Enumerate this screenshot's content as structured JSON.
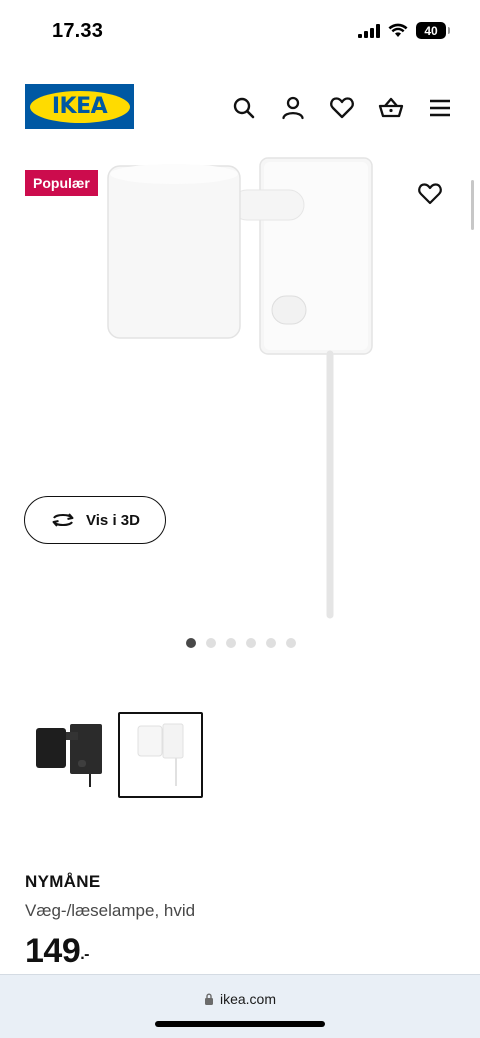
{
  "status_bar": {
    "time": "17.33",
    "battery": "40",
    "icons": [
      "signal-icon",
      "wifi-icon",
      "battery-icon"
    ]
  },
  "header": {
    "logo_text": "IKEA",
    "icons": [
      "search-icon",
      "user-icon",
      "heart-icon",
      "basket-icon",
      "menu-icon"
    ]
  },
  "product_image": {
    "badge": "Populær",
    "view_3d_label": "Vis i 3D",
    "carousel_count": 6,
    "carousel_active_index": 0
  },
  "thumbnails": [
    {
      "name": "black-lamp",
      "selected": false
    },
    {
      "name": "white-lamp",
      "selected": true
    }
  ],
  "product": {
    "name": "NYMÅNE",
    "description": "Væg-/læselampe, hvid",
    "price": "149",
    "price_suffix": ".-"
  },
  "browser": {
    "url": "ikea.com"
  },
  "colors": {
    "brand_blue": "#0058a3",
    "brand_yellow": "#ffdb00",
    "badge_red": "#cc0c4d"
  }
}
